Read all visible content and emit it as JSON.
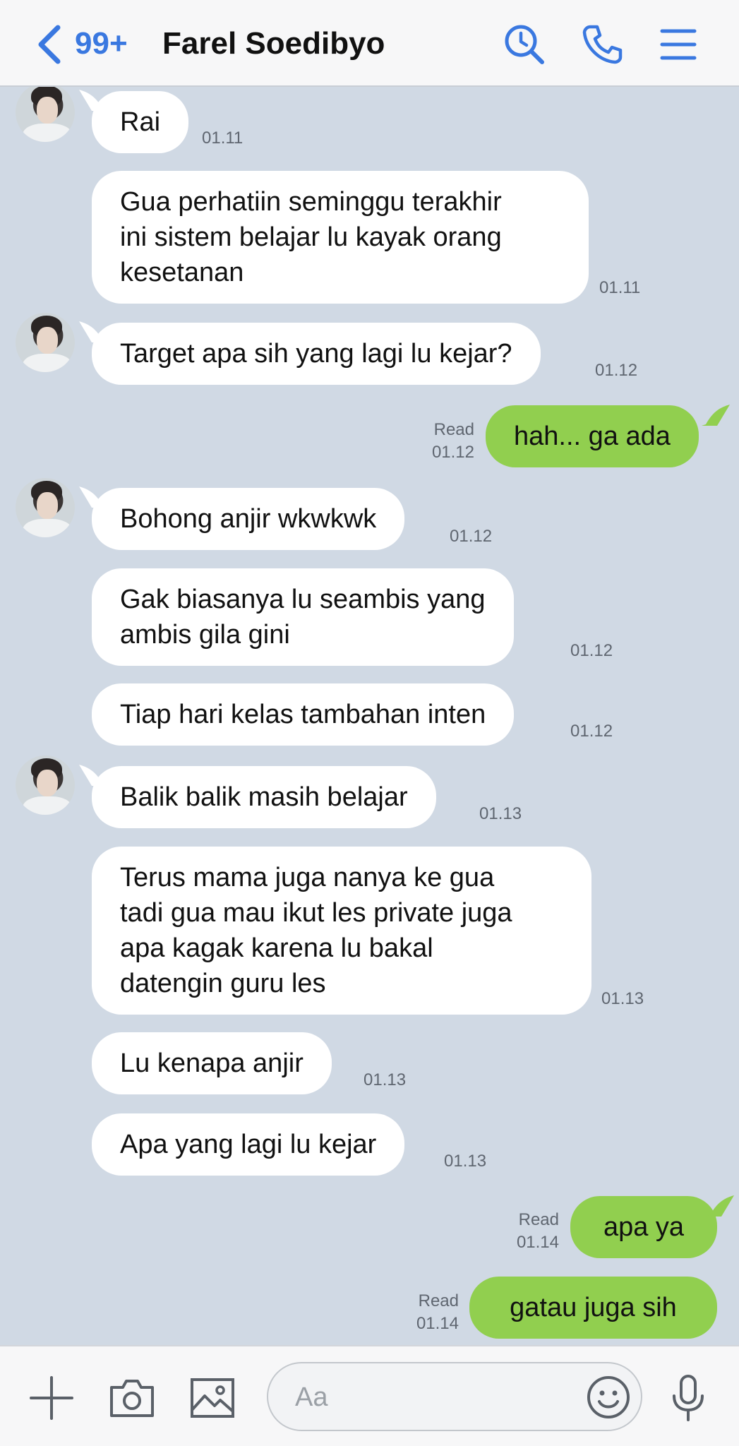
{
  "header": {
    "unread_count": "99+",
    "title": "Farel Soedibyo"
  },
  "messages": [
    {
      "text": "Rai",
      "time": "01.11"
    },
    {
      "text": "Gua perhatiin seminggu terakhir\nini sistem belajar lu kayak orang\nkesetanan",
      "time": "01.11"
    },
    {
      "text": "Target apa sih yang lagi lu kejar?",
      "time": "01.12"
    },
    {
      "text": "hah... ga ada",
      "read": "Read",
      "time": "01.12"
    },
    {
      "text": "Bohong anjir wkwkwk",
      "time": "01.12"
    },
    {
      "text": "Gak biasanya lu seambis yang\nambis gila gini",
      "time": "01.12"
    },
    {
      "text": "Tiap hari kelas tambahan inten",
      "time": "01.12"
    },
    {
      "text": "Balik balik masih belajar",
      "time": "01.13"
    },
    {
      "text": "Terus mama juga nanya ke gua\ntadi gua mau ikut les private juga\napa kagak karena lu bakal\ndatengin guru les",
      "time": "01.13"
    },
    {
      "text": "Lu kenapa anjir",
      "time": "01.13"
    },
    {
      "text": "Apa yang lagi lu kejar",
      "time": "01.13"
    },
    {
      "text": "apa ya",
      "read": "Read",
      "time": "01.14"
    },
    {
      "text": "gatau juga sih",
      "read": "Read",
      "time": "01.14"
    }
  ],
  "composer": {
    "placeholder": "Aa"
  },
  "colors": {
    "accent": "#3a78e0",
    "chat_background": "#d0d9e4",
    "outgoing_bubble": "#91cf4f",
    "incoming_bubble": "#ffffff"
  },
  "icons": {
    "header": [
      "chevron-left-icon",
      "search-history-icon",
      "phone-icon",
      "menu-icon"
    ],
    "composer": [
      "plus-icon",
      "camera-icon",
      "image-icon",
      "emoji-icon",
      "microphone-icon"
    ]
  }
}
